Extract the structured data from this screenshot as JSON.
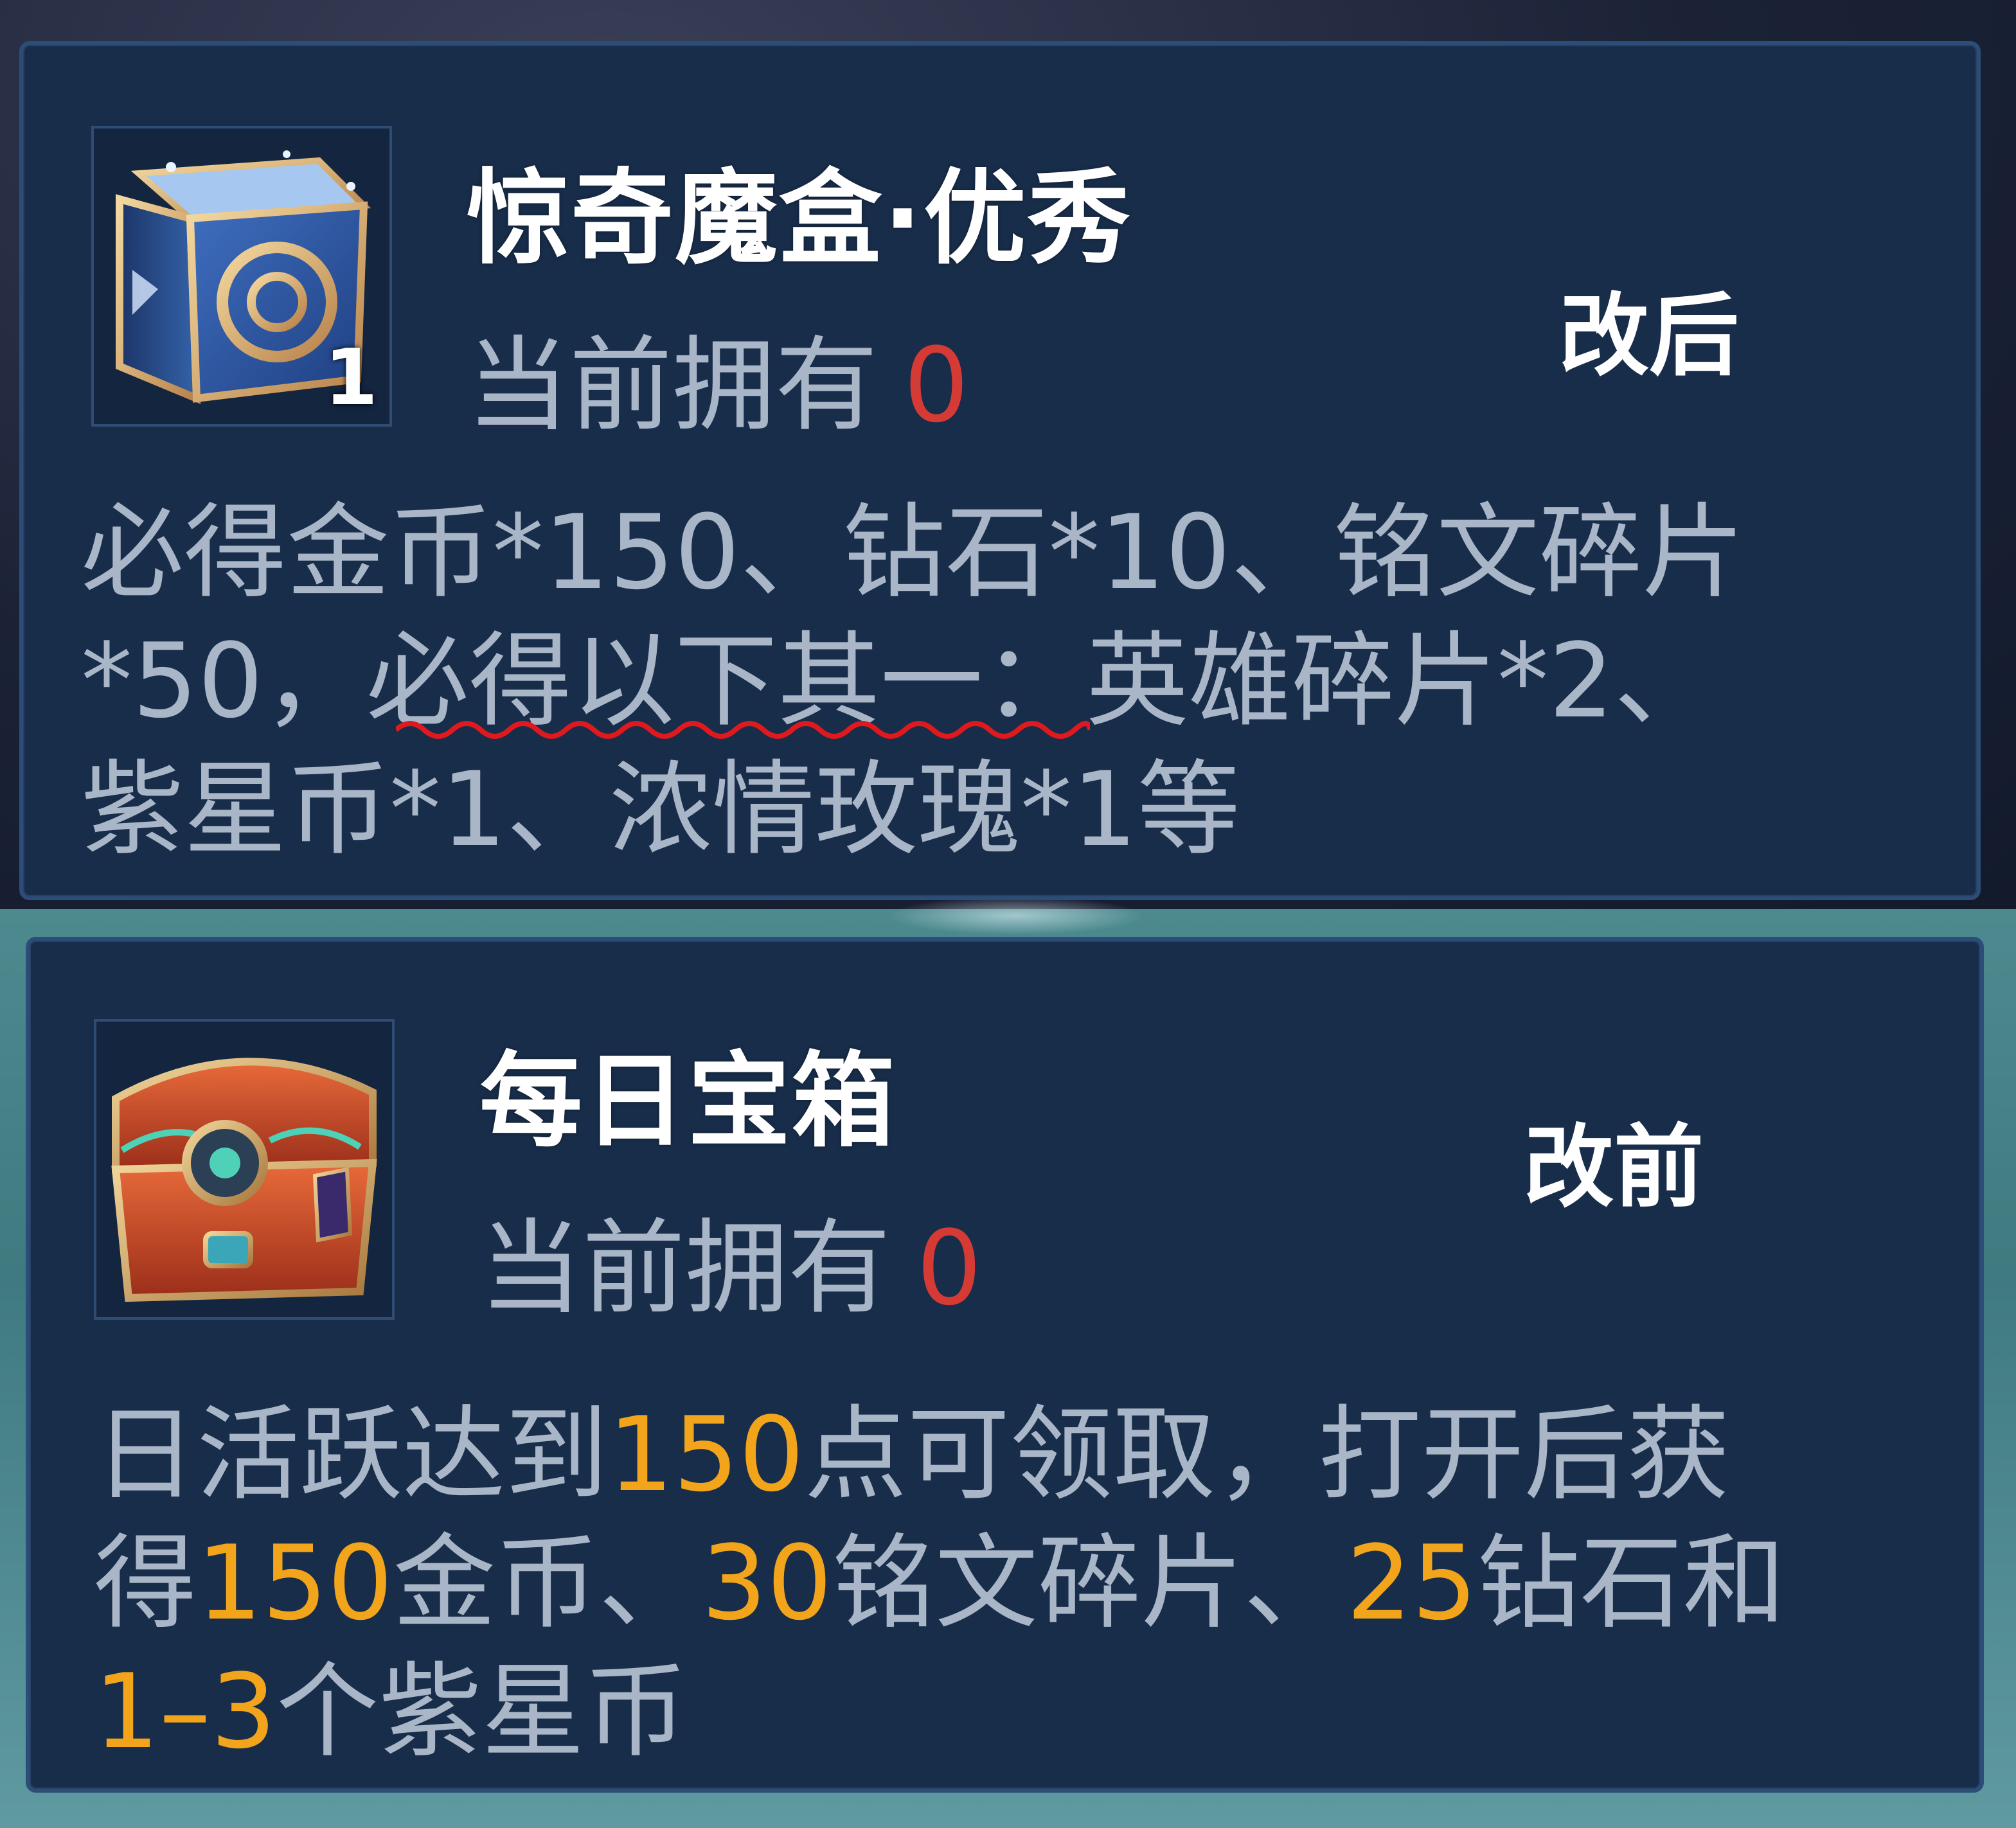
{
  "panel_after": {
    "item_name": "惊奇魔盒·优秀",
    "item_count": "1",
    "owned_label": "当前拥有",
    "owned_value": "0",
    "tag": "改后",
    "desc_lines": [
      "必得金币*150、钻石*10、铭文碎片",
      "*50，必得以下其一：英雄碎片*2、",
      "紫星币*1、浓情玫瑰*1等"
    ],
    "desc_line2_parts": [
      "*50，",
      "必得以下其一",
      "：英雄碎片*2、"
    ]
  },
  "panel_before": {
    "item_name": "每日宝箱",
    "owned_label": "当前拥有",
    "owned_value": "0",
    "tag": "改前",
    "desc_line1": [
      "日活跃达到",
      "150",
      "点可领取，打开后获"
    ],
    "desc_line2": [
      "得",
      "150",
      "金币、",
      "30",
      "铭文碎片、",
      "25",
      "钻石和"
    ],
    "desc_line3": [
      "1–3",
      "个紫星币"
    ]
  },
  "colors": {
    "panel_bg": "#182d4a",
    "panel_border": "#2c4d78",
    "desc_text": "#a9b6c8",
    "owned_zero": "#d63a35",
    "highlight": "#f2a51b",
    "underline": "#e0191e"
  },
  "icons": {
    "after_item": "magic-box-icon",
    "before_item": "treasure-chest-icon"
  }
}
